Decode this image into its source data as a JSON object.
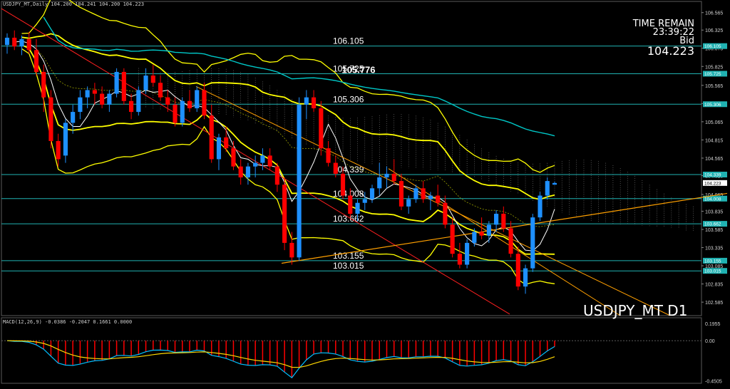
{
  "header": {
    "title": "USDJPY_MT,Daily  104.200 104.241 104.200 104.223"
  },
  "info": {
    "time_label": "TIME REMAIN",
    "time_value": "23:39:22",
    "bid_label": "Bid",
    "bid_value": "104.223"
  },
  "symbol_label": "USDJPY_MT D1",
  "macd_header": "MACD(12,26,9) -0.0386 -0.2047 0.1661 0.0000",
  "colors": {
    "background": "#000000",
    "bull_candle": "#1e90ff",
    "bear_candle": "#ff0000",
    "bollinger": "#ffff00",
    "ma_long": "#00c8c8",
    "ma_short": "#ffffff",
    "hline": "#20b2b2",
    "trend_red": "#ff2020",
    "trend_orange": "#ffa000",
    "ichimoku_cloud": "#bdbdbd",
    "signal_line": "#ffd700",
    "macd_line": "#00bfff"
  },
  "chart_data": {
    "type": "candlestick",
    "y_axis": {
      "ticks": [
        "106.565",
        "106.325",
        "106.075",
        "105.825",
        "105.565",
        "105.315",
        "105.065",
        "104.815",
        "104.565",
        "104.325",
        "104.065",
        "103.835",
        "103.585",
        "103.335",
        "103.085",
        "102.835",
        "102.585"
      ],
      "ylim": [
        102.4,
        106.66
      ]
    },
    "price_level_labels": [
      {
        "value": 106.105,
        "label": "106.105",
        "tag": "106.105"
      },
      {
        "value": 105.725,
        "label": "105.725",
        "tag": "105.725"
      },
      {
        "value": 105.306,
        "label": "105.306",
        "tag": "105.306"
      },
      {
        "value": 104.339,
        "label": "104.339",
        "tag": "104.339"
      },
      {
        "value": 104.008,
        "label": "104.008",
        "tag": "104.008"
      },
      {
        "value": 103.662,
        "label": "103.662",
        "tag": "103.662"
      },
      {
        "value": 103.155,
        "label": "103.155",
        "tag": "103.155"
      },
      {
        "value": 103.015,
        "label": "103.015",
        "tag": "103.015"
      }
    ],
    "peak_label": {
      "value": 105.776,
      "text": "105.776",
      "bar": 48
    },
    "current_price_tag": "104.223",
    "candles": [
      [
        106.12,
        106.28,
        106.0,
        106.22
      ],
      [
        106.22,
        106.32,
        106.05,
        106.1
      ],
      [
        106.1,
        106.25,
        105.98,
        106.2
      ],
      [
        106.2,
        106.3,
        106.0,
        106.05
      ],
      [
        106.05,
        106.2,
        105.7,
        105.75
      ],
      [
        105.75,
        105.85,
        105.2,
        105.4
      ],
      [
        105.4,
        105.5,
        104.7,
        104.8
      ],
      [
        104.8,
        104.9,
        104.45,
        104.55
      ],
      [
        104.6,
        105.1,
        104.5,
        105.05
      ],
      [
        105.05,
        105.3,
        104.9,
        105.2
      ],
      [
        105.2,
        105.5,
        105.1,
        105.4
      ],
      [
        105.4,
        105.55,
        105.25,
        105.5
      ],
      [
        105.5,
        105.6,
        105.3,
        105.45
      ],
      [
        105.45,
        105.55,
        105.25,
        105.3
      ],
      [
        105.3,
        105.5,
        105.2,
        105.45
      ],
      [
        105.45,
        105.8,
        105.4,
        105.75
      ],
      [
        105.75,
        105.8,
        105.3,
        105.35
      ],
      [
        105.35,
        105.45,
        105.1,
        105.2
      ],
      [
        105.2,
        105.55,
        105.15,
        105.5
      ],
      [
        105.5,
        105.8,
        105.45,
        105.7
      ],
      [
        105.7,
        105.85,
        105.55,
        105.6
      ],
      [
        105.6,
        105.7,
        105.35,
        105.4
      ],
      [
        105.4,
        105.5,
        105.2,
        105.3
      ],
      [
        105.3,
        105.4,
        105.0,
        105.05
      ],
      [
        105.05,
        105.4,
        105.0,
        105.35
      ],
      [
        105.35,
        105.5,
        105.2,
        105.25
      ],
      [
        105.25,
        105.55,
        105.2,
        105.5
      ],
      [
        105.5,
        105.6,
        105.1,
        105.15
      ],
      [
        105.15,
        105.3,
        104.5,
        104.55
      ],
      [
        104.55,
        104.9,
        104.4,
        104.85
      ],
      [
        104.85,
        105.0,
        104.65,
        104.7
      ],
      [
        104.7,
        104.8,
        104.4,
        104.45
      ],
      [
        104.45,
        104.55,
        104.2,
        104.3
      ],
      [
        104.3,
        104.5,
        104.2,
        104.45
      ],
      [
        104.45,
        104.6,
        104.3,
        104.5
      ],
      [
        104.5,
        104.7,
        104.4,
        104.6
      ],
      [
        104.6,
        104.7,
        104.4,
        104.45
      ],
      [
        104.45,
        104.5,
        104.1,
        104.2
      ],
      [
        104.2,
        104.3,
        103.3,
        103.4
      ],
      [
        103.4,
        103.55,
        103.1,
        103.2
      ],
      [
        103.2,
        105.4,
        103.15,
        105.3
      ],
      [
        105.3,
        105.5,
        105.1,
        105.4
      ],
      [
        105.4,
        105.5,
        105.2,
        105.25
      ],
      [
        105.25,
        105.35,
        104.6,
        104.7
      ],
      [
        104.7,
        104.8,
        104.45,
        104.5
      ],
      [
        104.5,
        104.6,
        104.3,
        104.35
      ],
      [
        104.35,
        104.45,
        104.0,
        104.05
      ],
      [
        104.05,
        104.15,
        103.75,
        103.8
      ],
      [
        103.8,
        104.0,
        103.7,
        103.95
      ],
      [
        103.95,
        104.1,
        103.85,
        104.0
      ],
      [
        104.0,
        104.2,
        103.95,
        104.15
      ],
      [
        104.15,
        104.5,
        104.05,
        104.3
      ],
      [
        104.3,
        104.45,
        104.15,
        104.35
      ],
      [
        104.35,
        104.55,
        104.2,
        104.25
      ],
      [
        104.25,
        104.35,
        103.85,
        103.9
      ],
      [
        103.9,
        104.05,
        103.8,
        104.0
      ],
      [
        104.0,
        104.2,
        103.95,
        104.15
      ],
      [
        104.15,
        104.25,
        103.95,
        104.0
      ],
      [
        104.0,
        104.1,
        103.85,
        104.05
      ],
      [
        104.05,
        104.2,
        103.9,
        103.95
      ],
      [
        103.95,
        104.05,
        103.6,
        103.65
      ],
      [
        103.65,
        103.75,
        103.2,
        103.25
      ],
      [
        103.25,
        103.4,
        103.05,
        103.1
      ],
      [
        103.1,
        103.45,
        103.05,
        103.4
      ],
      [
        103.4,
        103.6,
        103.35,
        103.55
      ],
      [
        103.55,
        103.75,
        103.45,
        103.5
      ],
      [
        103.5,
        103.7,
        103.4,
        103.65
      ],
      [
        103.65,
        103.85,
        103.55,
        103.8
      ],
      [
        103.8,
        103.9,
        103.55,
        103.6
      ],
      [
        103.6,
        103.7,
        103.2,
        103.25
      ],
      [
        103.25,
        103.35,
        102.75,
        102.8
      ],
      [
        102.8,
        103.1,
        102.7,
        103.05
      ],
      [
        103.05,
        103.8,
        103.0,
        103.75
      ],
      [
        103.75,
        104.1,
        103.7,
        104.05
      ],
      [
        104.05,
        104.3,
        104.0,
        104.25
      ],
      [
        104.2,
        104.24,
        104.2,
        104.223
      ]
    ],
    "macd": {
      "header": "MACD(12,26,9) -0.0386 -0.2047 0.1661 0.0000",
      "y_ticks": [
        "0.1955",
        "0.00",
        "-0.4505"
      ],
      "ylim": [
        -0.48,
        0.21
      ]
    }
  }
}
